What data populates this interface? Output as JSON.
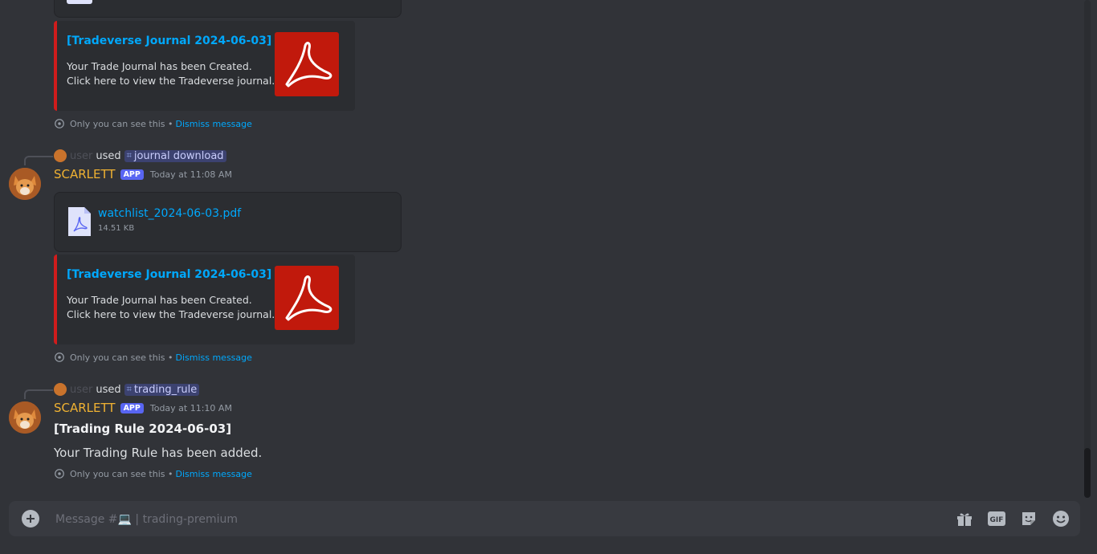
{
  "colors": {
    "bg": "#313338",
    "embed_accent": "#d01c1c",
    "link": "#00a8fc",
    "author": "#f0b232",
    "app_badge": "#5865f2"
  },
  "top_embed": {
    "title": "[Tradeverse Journal 2024-06-03]",
    "line1": "Your Trade Journal has been Created.",
    "line2": "Click here to view the Tradeverse journal."
  },
  "ephemeral": {
    "text": "Only you can see this •",
    "dismiss": "Dismiss message"
  },
  "msg1": {
    "reply_user": "user",
    "reply_used": "used",
    "command": "journal download",
    "author": "SCARLETT",
    "badge": "APP",
    "time": "Today at 11:08 AM",
    "file": {
      "name": "watchlist_2024-06-03.pdf",
      "size": "14.51 KB"
    },
    "embed": {
      "title": "[Tradeverse Journal 2024-06-03]",
      "line1": "Your Trade Journal has been Created.",
      "line2": "Click here to view the Tradeverse journal."
    }
  },
  "msg2": {
    "reply_user": "user",
    "reply_used": "used",
    "command": "trading_rule",
    "author": "SCARLETT",
    "badge": "APP",
    "time": "Today at 11:10 AM",
    "bold_line": "[Trading Rule 2024-06-03]",
    "body": "Your Trading Rule has been added."
  },
  "composer": {
    "placeholder": "Message #💻 | trading-premium"
  },
  "icons": [
    "eye-icon",
    "pdf-icon",
    "plus-icon",
    "gift-icon",
    "gif-icon",
    "sticker-icon",
    "emoji-icon",
    "slash-command-icon"
  ]
}
